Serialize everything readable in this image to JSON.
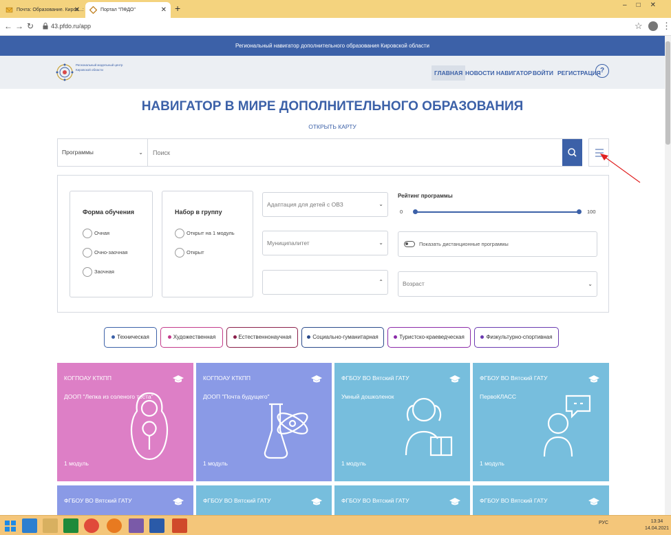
{
  "browser": {
    "tabs": [
      {
        "label": "Почта: Образование. Киров...: "
      },
      {
        "label": "Портал \"ПФДО\""
      }
    ],
    "url": "43.pfdo.ru/app"
  },
  "site": {
    "banner": "Региональный навигатор дополнительного образования Кировской области",
    "logo_text": "Региональный модельный центр Кировской области",
    "menu": [
      {
        "label": "ГЛАВНАЯ"
      },
      {
        "label": "НОВОСТИ"
      },
      {
        "label": "НАВИГАТОР"
      },
      {
        "label": "ВОЙТИ"
      },
      {
        "label": "РЕГИСТРАЦИЯ"
      }
    ],
    "help_label": "?"
  },
  "hero": {
    "title": "НАВИГАТОР В МИРЕ ДОПОЛНИТЕЛЬНОГО ОБРАЗОВАНИЯ",
    "open_map": "ОТКРЫТЬ КАРТУ"
  },
  "search": {
    "category_value": "Программы",
    "placeholder": "Поиск"
  },
  "filters": {
    "form": {
      "title": "Форма обучения",
      "options": [
        "Очная",
        "Очно-заочная",
        "Заочная"
      ]
    },
    "group": {
      "title": "Набор в группу",
      "options": [
        "Открыт на 1 модуль",
        "Открыт"
      ]
    },
    "adaptation": "Адаптация для детей с ОВЗ",
    "municipality": "Муниципалитет",
    "empty_select": "",
    "rating": {
      "label": "Рейтинг программы",
      "min": "0",
      "max": "100",
      "range_from": 0,
      "range_to": 100
    },
    "distance": "Показать дистанционные программы",
    "age": "Возраст"
  },
  "categories": [
    {
      "label": "Техническая",
      "color": "#3c61a8"
    },
    {
      "label": "Художественная",
      "color": "#c33a8a"
    },
    {
      "label": "Естественнонаучная",
      "color": "#8a1f4a"
    },
    {
      "label": "Социально-гуманитарная",
      "color": "#2a4a8a"
    },
    {
      "label": "Туристско-краеведческая",
      "color": "#8a2aa8"
    },
    {
      "label": "Физкультурно-спортивная",
      "color": "#6a3ab0"
    }
  ],
  "cards": [
    {
      "org": "КОГПОАУ КТКПП",
      "program": "ДООП \"Лепка из соленого теста\"",
      "modules": "1 модуль",
      "color": "#dd7fc6",
      "icon": "matryoshka-icon"
    },
    {
      "org": "КОГПОАУ КТКПП",
      "program": "ДООП \"Почта будущего\"",
      "modules": "1 модуль",
      "color": "#8a9ae6",
      "icon": "science-icon"
    },
    {
      "org": "ФГБОУ ВО Вятский ГАТУ",
      "program": "Умный дошколенок",
      "modules": "1 модуль",
      "color": "#77bedd",
      "icon": "girl-reading-icon"
    },
    {
      "org": "ФГБОУ ВО Вятский ГАТУ",
      "program": "ПервоКЛАСС",
      "modules": "1 модуль",
      "color": "#77bedd",
      "icon": "person-speech-icon"
    },
    {
      "org": "ФГБОУ ВО Вятский ГАТУ",
      "color": "#8a9ae6"
    },
    {
      "org": "ФГБОУ ВО Вятский ГАТУ",
      "color": "#77bedd"
    },
    {
      "org": "ФГБОУ ВО Вятский ГАТУ",
      "color": "#77bedd"
    },
    {
      "org": "ФГБОУ ВО Вятский ГАТУ",
      "color": "#77bedd"
    }
  ],
  "taskbar": {
    "tray_lang": "РУС",
    "time": "13:34",
    "date": "14.04.2021"
  }
}
